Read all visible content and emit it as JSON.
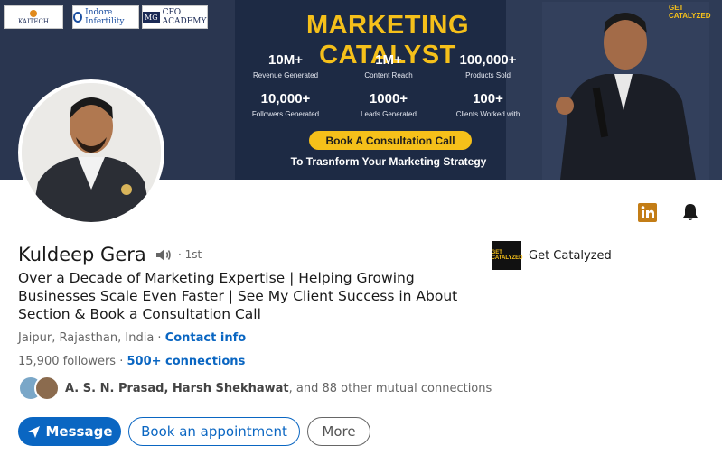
{
  "banner": {
    "logos": [
      "KAITECH",
      "Indore Infertility",
      "CFO ACADEMY"
    ],
    "logo_mg": "MG",
    "title": "MARKETING CATALYST",
    "brand": "GET CATALYZED",
    "stats": [
      {
        "value": "10M+",
        "label": "Revenue Generated"
      },
      {
        "value": "1M+",
        "label": "Content Reach"
      },
      {
        "value": "100,000+",
        "label": "Products Sold"
      },
      {
        "value": "10,000+",
        "label": "Followers Generated"
      },
      {
        "value": "1000+",
        "label": "Leads Generated"
      },
      {
        "value": "100+",
        "label": "Clients Worked with"
      }
    ],
    "cta": "Book A Consultation Call",
    "subtitle": "To Trasnform Your Marketing Strategy",
    "accent_color": "#f5c01a",
    "background_color": "#1d2a44"
  },
  "profile": {
    "name": "Kuldeep Gera",
    "degree": "· 1st",
    "headline": "Over a Decade of Marketing Expertise | Helping Growing Businesses Scale Even Faster | See My Client Success in About Section & Book a Consultation Call",
    "location": "Jaipur, Rajasthan, India",
    "location_sep": " · ",
    "contact_info": "Contact info",
    "followers": "15,900 followers",
    "connections_sep": " · ",
    "connections": "500+ connections",
    "mutual": {
      "names": "A. S. N. Prasad, Harsh Shekhawat",
      "rest": ", and 88 other mutual connections"
    }
  },
  "company": {
    "name": "Get Catalyzed",
    "logo_text": "GET CATALYZED"
  },
  "actions": {
    "message": "Message",
    "book": "Book an appointment",
    "more": "More"
  },
  "icons": [
    "linkedin-icon",
    "bell-icon",
    "speaker-icon",
    "send-icon"
  ],
  "colors": {
    "link": "#0a66c2",
    "primary_button": "#0a66c2",
    "text": "#191919",
    "muted": "#666666"
  }
}
